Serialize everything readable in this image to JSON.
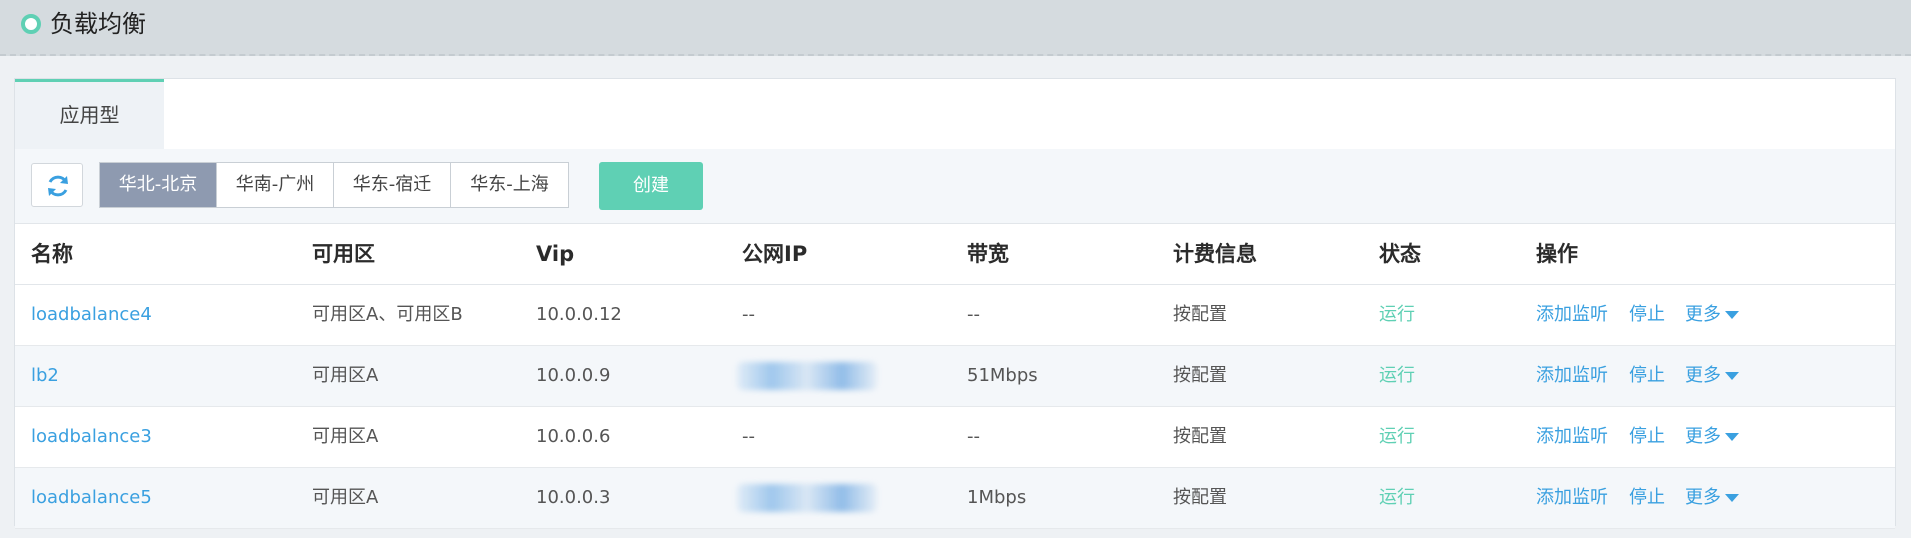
{
  "header": {
    "title": "负载均衡"
  },
  "tabs": [
    {
      "label": "应用型"
    }
  ],
  "toolbar": {
    "refresh_icon": "refresh-icon",
    "regions": [
      {
        "label": "华北-北京",
        "active": true
      },
      {
        "label": "华南-广州",
        "active": false
      },
      {
        "label": "华东-宿迁",
        "active": false
      },
      {
        "label": "华东-上海",
        "active": false
      }
    ],
    "create_label": "创建"
  },
  "table": {
    "columns": [
      "名称",
      "可用区",
      "Vip",
      "公网IP",
      "带宽",
      "计费信息",
      "状态",
      "操作"
    ],
    "rows": [
      {
        "name": "loadbalance4",
        "zone": "可用区A、可用区B",
        "vip": "10.0.0.12",
        "public_ip": "--",
        "bandwidth": "--",
        "billing": "按配置",
        "status": "运行",
        "op_add": "添加监听",
        "op_stop": "停止",
        "op_more": "更多"
      },
      {
        "name": "lb2",
        "zone": "可用区A",
        "vip": "10.0.0.9",
        "public_ip": "",
        "bandwidth": "51Mbps",
        "billing": "按配置",
        "status": "运行",
        "op_add": "添加监听",
        "op_stop": "停止",
        "op_more": "更多"
      },
      {
        "name": "loadbalance3",
        "zone": "可用区A",
        "vip": "10.0.0.6",
        "public_ip": "--",
        "bandwidth": "--",
        "billing": "按配置",
        "status": "运行",
        "op_add": "添加监听",
        "op_stop": "停止",
        "op_more": "更多"
      },
      {
        "name": "loadbalance5",
        "zone": "可用区A",
        "vip": "10.0.0.3",
        "public_ip": "",
        "bandwidth": "1Mbps",
        "billing": "按配置",
        "status": "运行",
        "op_add": "添加监听",
        "op_stop": "停止",
        "op_more": "更多"
      }
    ]
  },
  "colors": {
    "accent": "#5fd0b4",
    "link": "#3aa0e0",
    "region_active": "#8e9ab0"
  }
}
